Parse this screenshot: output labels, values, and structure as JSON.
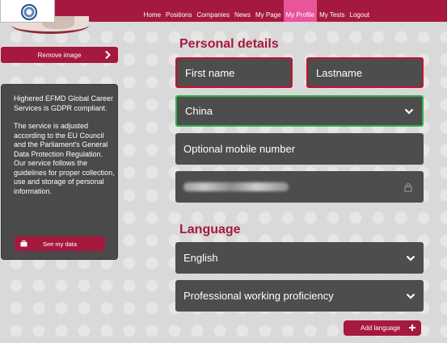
{
  "nav": {
    "items": [
      {
        "label": "Home",
        "active": false
      },
      {
        "label": "Positions",
        "active": false
      },
      {
        "label": "Companies",
        "active": false
      },
      {
        "label": "News",
        "active": false
      },
      {
        "label": "My Page",
        "active": false
      },
      {
        "label": "My Profile",
        "active": true
      },
      {
        "label": "My Tests",
        "active": false
      },
      {
        "label": "Logout",
        "active": false
      }
    ]
  },
  "sidebar": {
    "remove_image_label": "Remove image",
    "info_paragraph_1": "Highered EFMD Global Career Services is GDPR compliant.",
    "info_paragraph_2": "The service is adjusted according to the EU Council and the Parliament's General Data Protection Regulation. Our service follows the guidelines for proper collection, use and storage of personal information.",
    "see_data_label": "See my data"
  },
  "personal": {
    "heading": "Personal details",
    "first_name_placeholder": "First name",
    "lastname_placeholder": "Lastname",
    "country_value": "China",
    "mobile_placeholder": "Optional mobile number"
  },
  "language": {
    "heading": "Language",
    "language_value": "English",
    "proficiency_value": "Professional working proficiency",
    "add_language_label": "Add language"
  },
  "colors": {
    "brand": "#a6193e",
    "active_tab": "#e9559a",
    "field_bg": "#4d4d4d",
    "error_border": "#c8102e",
    "valid_border": "#2fb24a"
  },
  "icons": {
    "remove_image": "chevron-right-icon",
    "see_data": "briefcase-icon",
    "country_select": "chevron-down-icon",
    "email_lock": "lock-icon",
    "add_language": "plus-icon"
  }
}
